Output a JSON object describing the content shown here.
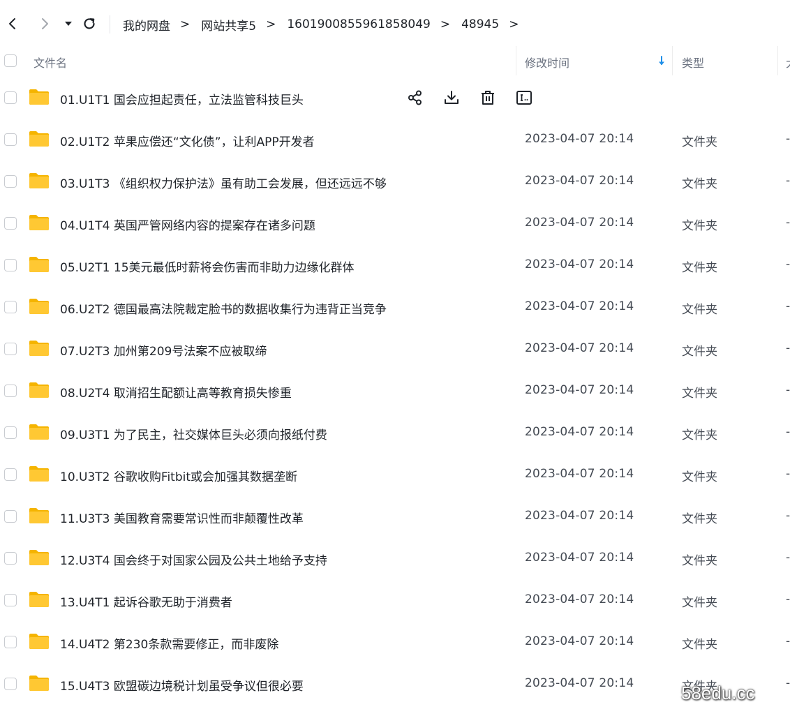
{
  "breadcrumb": [
    "我的网盘",
    "网站共享5",
    "1601900855961858049",
    "48945"
  ],
  "breadcrumb_separator": ">",
  "columns": {
    "name": "文件名",
    "modified": "修改时间",
    "type": "类型",
    "size": "大"
  },
  "colors": {
    "folder": "#FFC833",
    "folder_back": "#F5B400",
    "sort_arrow": "#1E8FE8",
    "text": "#1F2329",
    "muted": "#454B54"
  },
  "files": [
    {
      "name": "01.U1T1 国会应担起责任，立法监管科技巨头",
      "date": "",
      "type": "",
      "size": ""
    },
    {
      "name": "02.U1T2 苹果应偿还“文化债”，让利APP开发者",
      "date": "2023-04-07 20:14",
      "type": "文件夹",
      "size": "-"
    },
    {
      "name": "03.U1T3 《组织权力保护法》虽有助工会发展，但还远远不够",
      "date": "2023-04-07 20:14",
      "type": "文件夹",
      "size": "-"
    },
    {
      "name": "04.U1T4 英国严管网络内容的提案存在诸多问题",
      "date": "2023-04-07 20:14",
      "type": "文件夹",
      "size": "-"
    },
    {
      "name": "05.U2T1 15美元最低时薪将会伤害而非助力边缘化群体",
      "date": "2023-04-07 20:14",
      "type": "文件夹",
      "size": "-"
    },
    {
      "name": "06.U2T2 德国最高法院裁定脸书的数据收集行为违背正当竞争",
      "date": "2023-04-07 20:14",
      "type": "文件夹",
      "size": "-"
    },
    {
      "name": "07.U2T3 加州第209号法案不应被取缔",
      "date": "2023-04-07 20:14",
      "type": "文件夹",
      "size": "-"
    },
    {
      "name": "08.U2T4 取消招生配额让高等教育损失惨重",
      "date": "2023-04-07 20:14",
      "type": "文件夹",
      "size": "-"
    },
    {
      "name": "09.U3T1 为了民主，社交媒体巨头必须向报纸付费",
      "date": "2023-04-07 20:14",
      "type": "文件夹",
      "size": "-"
    },
    {
      "name": "10.U3T2 谷歌收购Fitbit或会加强其数据垄断",
      "date": "2023-04-07 20:14",
      "type": "文件夹",
      "size": "-"
    },
    {
      "name": "11.U3T3 美国教育需要常识性而非颠覆性改革",
      "date": "2023-04-07 20:14",
      "type": "文件夹",
      "size": "-"
    },
    {
      "name": "12.U3T4 国会终于对国家公园及公共土地给予支持",
      "date": "2023-04-07 20:14",
      "type": "文件夹",
      "size": "-"
    },
    {
      "name": "13.U4T1 起诉谷歌无助于消费者",
      "date": "2023-04-07 20:14",
      "type": "文件夹",
      "size": "-"
    },
    {
      "name": "14.U4T2 第230条款需要修正，而非废除",
      "date": "2023-04-07 20:14",
      "type": "文件夹",
      "size": "-"
    },
    {
      "name": "15.U4T3 欧盟碳边境税计划虽受争议但很必要",
      "date": "2023-04-07 20:14",
      "type": "文件夹",
      "size": "-"
    }
  ],
  "hover_actions": [
    "share-icon",
    "download-icon",
    "delete-icon",
    "rename-icon"
  ],
  "watermark": "58edu.cc"
}
